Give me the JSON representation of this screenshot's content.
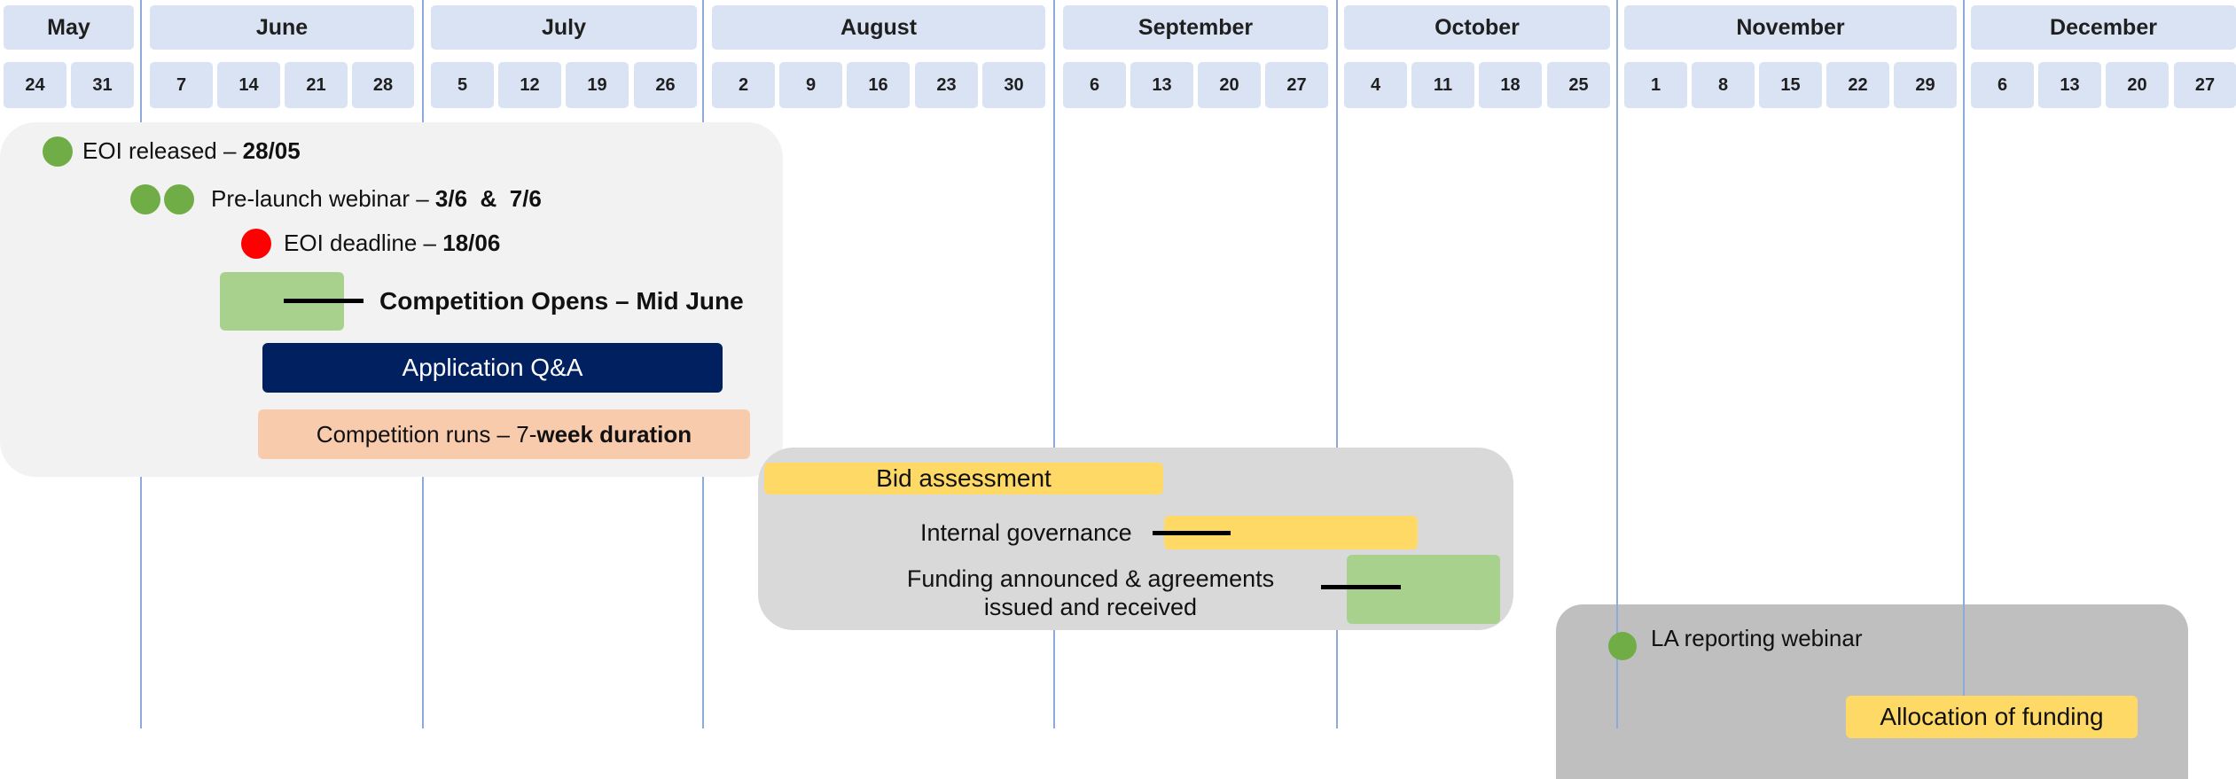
{
  "months": [
    "May",
    "June",
    "July",
    "August",
    "September",
    "October",
    "November",
    "December"
  ],
  "weeks": [
    "24",
    "31",
    "7",
    "14",
    "21",
    "28",
    "5",
    "12",
    "19",
    "26",
    "2",
    "9",
    "16",
    "23",
    "30",
    "6",
    "13",
    "20",
    "27",
    "4",
    "11",
    "18",
    "25",
    "1",
    "8",
    "15",
    "22",
    "29",
    "6",
    "13",
    "20",
    "27"
  ],
  "phase1": {
    "eoi_released": {
      "label": "EOI released – ",
      "date": "28/05"
    },
    "webinar": {
      "label": "Pre-launch webinar – ",
      "dates": "3/6  &  7/6"
    },
    "eoi_deadline": {
      "label": "EOI deadline – ",
      "date": "18/06"
    },
    "competition_opens": "Competition Opens – Mid June",
    "application_qa": "Application Q&A",
    "competition_runs": {
      "prefix": "Competition runs – 7-",
      "emphasis": "week duration"
    }
  },
  "phase2": {
    "bid_assessment": "Bid assessment",
    "internal_governance": "Internal governance",
    "funding_line1": "Funding announced & agreements",
    "funding_line2": "issued and received"
  },
  "phase3": {
    "la_webinar": "LA reporting webinar",
    "allocation": "Allocation of funding"
  },
  "colors": {
    "header_fill": "#dae3f3",
    "gridline": "#8eaadb",
    "milestone_green": "#70ad47",
    "deadline_red": "#ff0000",
    "navy": "#002060",
    "peach": "#f8cbad",
    "yellow": "#ffd966",
    "light_green": "#a9d18e",
    "panel1": "#f2f2f2",
    "panel2": "#d9d9d9",
    "panel3": "#bfbfbf"
  }
}
